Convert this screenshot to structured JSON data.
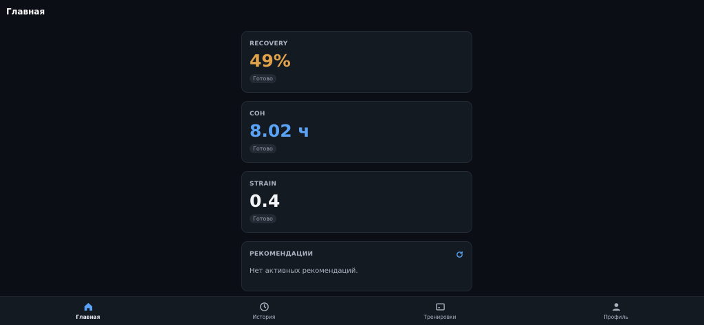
{
  "header": {
    "title": "Главная"
  },
  "cards": {
    "recovery": {
      "label": "RECOVERY",
      "value": "49%",
      "status": "Готово"
    },
    "sleep": {
      "label": "СОН",
      "value": "8.02 ч",
      "status": "Готово"
    },
    "strain": {
      "label": "STRAIN",
      "value": "0.4",
      "status": "Готово"
    },
    "recommendations": {
      "label": "РЕКОМЕНДАЦИИ",
      "empty_text": "Нет активных рекомендаций.",
      "icon": "refresh-icon"
    }
  },
  "colors": {
    "accent": "#5aa2f6",
    "recovery": "#e0a24a",
    "background": "#0b0e15",
    "card": "#141a22"
  },
  "tabbar": {
    "tabs": [
      {
        "label": "Главная",
        "icon": "home-icon",
        "active": true
      },
      {
        "label": "История",
        "icon": "clock-icon",
        "active": false
      },
      {
        "label": "Тренировки",
        "icon": "workout-icon",
        "active": false
      },
      {
        "label": "Профиль",
        "icon": "person-icon",
        "active": false
      }
    ]
  }
}
